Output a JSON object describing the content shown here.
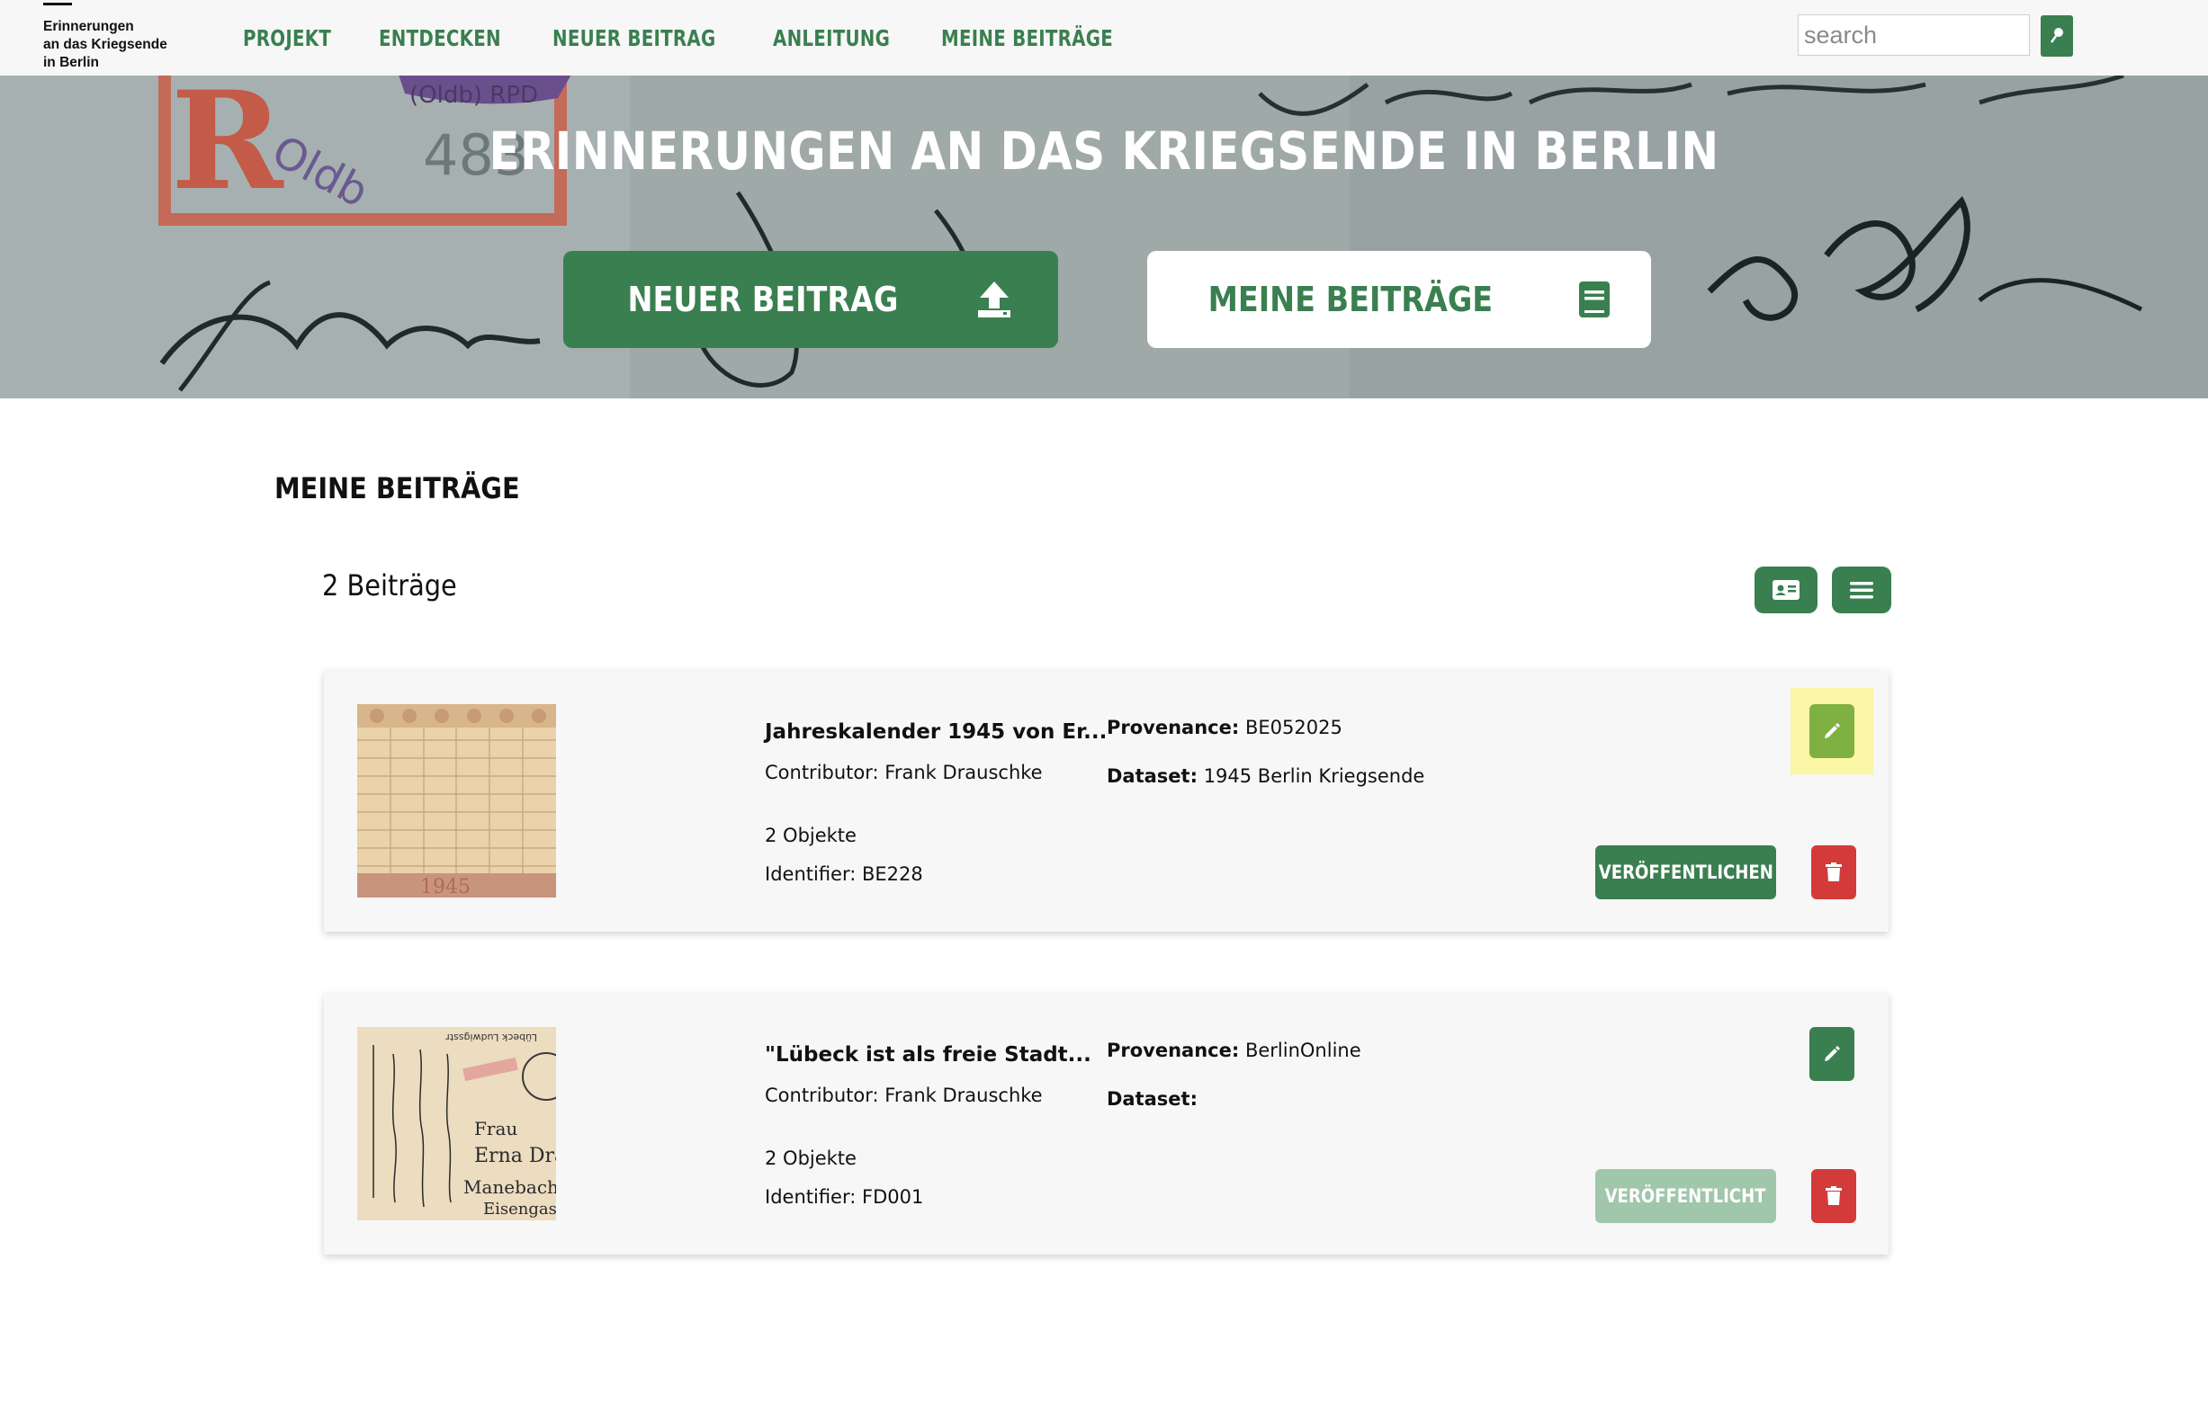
{
  "header": {
    "logo_lines": [
      "Erinnerungen",
      "an das Kriegsende",
      "in Berlin"
    ],
    "nav": [
      "PROJEKT",
      "ENTDECKEN",
      "NEUER BEITRAG",
      "ANLEITUNG",
      "MEINE BEITRÄGE"
    ],
    "search_placeholder": "search",
    "search_icon": "magnifier-icon"
  },
  "hero": {
    "title": "ERINNERUNGEN AN DAS KRIEGSENDE IN BERLIN",
    "new_button": "NEUER BEITRAG",
    "new_icon": "upload-icon",
    "mine_button": "MEINE BEITRÄGE",
    "mine_icon": "book-icon"
  },
  "main": {
    "section_title": "MEINE BEITRÄGE",
    "count": "2 Beiträge",
    "view_icons": [
      "card-view-icon",
      "list-view-icon"
    ]
  },
  "contributions": [
    {
      "title": "Jahreskalender 1945 von Er...",
      "contributor_label": "Contributor:",
      "contributor": "Frank Drauschke",
      "objects": "2 Objekte",
      "identifier_label": "Identifier:",
      "identifier": "BE228",
      "provenance_label": "Provenance:",
      "provenance": "BE052025",
      "dataset_label": "Dataset:",
      "dataset": "1945 Berlin Kriegsende",
      "publish_label": "VERÖFFENTLICHEN",
      "published": false,
      "publish_color": "#3a7f50"
    },
    {
      "title": "\"Lübeck ist als freie Stadt...",
      "contributor_label": "Contributor:",
      "contributor": "Frank Drauschke",
      "objects": "2 Objekte",
      "identifier_label": "Identifier:",
      "identifier": "FD001",
      "provenance_label": "Provenance:",
      "provenance": "BerlinOnline",
      "dataset_label": "Dataset:",
      "dataset": "",
      "publish_label": "VERÖFFENTLICHT",
      "published": true,
      "publish_color": "#a0c6ab"
    }
  ],
  "colors": {
    "brand_green": "#3a7f50",
    "delete_red": "#d33a3a",
    "highlight_yellow": "#fbf5a6",
    "highlight_edit_green": "#7fb042"
  }
}
